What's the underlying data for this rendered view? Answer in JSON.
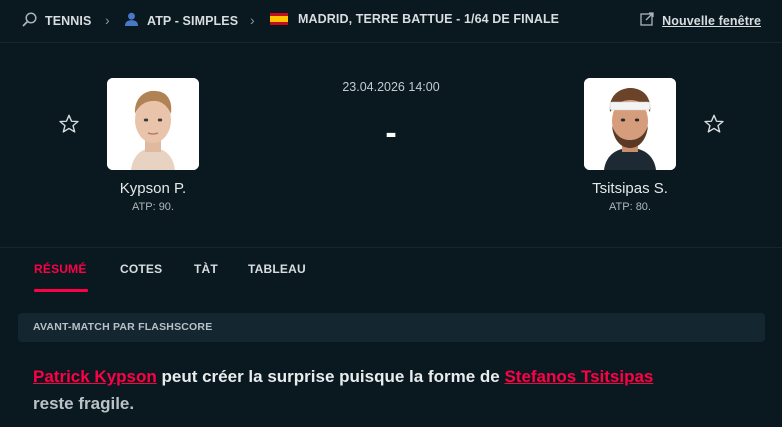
{
  "breadcrumb": {
    "sport": "TENNIS",
    "category": "ATP - SIMPLES",
    "tournament": "MADRID, TERRE BATTUE - 1/64 DE FINALE"
  },
  "header": {
    "new_window_label": "Nouvelle fenêtre"
  },
  "match": {
    "datetime": "23.04.2026 14:00",
    "score": "-",
    "home": {
      "name": "Kypson P.",
      "rank": "ATP: 90."
    },
    "away": {
      "name": "Tsitsipas S.",
      "rank": "ATP: 80."
    }
  },
  "tabs": [
    {
      "label": "RÉSUMÉ",
      "active": true
    },
    {
      "label": "COTES",
      "active": false
    },
    {
      "label": "TÀT",
      "active": false
    },
    {
      "label": "TABLEAU",
      "active": false
    }
  ],
  "preview": {
    "title": "AVANT-MATCH PAR FLASHSCORE",
    "link1": "Patrick Kypson",
    "text1": " peut créer la surprise puisque la forme de ",
    "link2": "Stefanos Tsitsipas",
    "text2": "reste fragile."
  },
  "colors": {
    "background": "#0a1820",
    "accent": "#ff0046",
    "panel": "#142731"
  },
  "icons": {
    "sport": "tennis-racket-icon",
    "category": "person-icon",
    "tournament": "spain-flag-icon",
    "new_window": "external-window-icon",
    "favorite": "star-outline-icon"
  }
}
